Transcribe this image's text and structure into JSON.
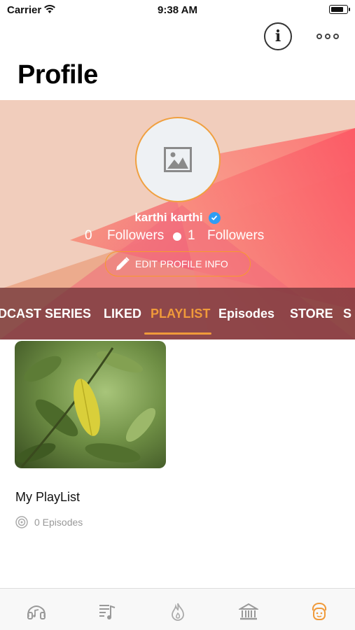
{
  "status_bar": {
    "carrier": "Carrier",
    "time": "9:38 AM",
    "battery_level": 0.85
  },
  "nav": {
    "info_glyph": "i"
  },
  "page_title": "Profile",
  "profile": {
    "name": "karthi karthi",
    "verified": true,
    "followers_count": "0",
    "followers_label": "Followers",
    "following_count": "1",
    "following_label": "Followers",
    "edit_button": "EDIT PROFILE INFO"
  },
  "tabs": [
    {
      "label": "DCAST SERIES",
      "active": false
    },
    {
      "label": "LIKED",
      "active": false
    },
    {
      "label": "PLAYLIST",
      "active": true
    },
    {
      "label": "Episodes",
      "active": false
    },
    {
      "label": "STORE",
      "active": false
    },
    {
      "label": "S",
      "active": false
    }
  ],
  "playlist": {
    "title": "My PlayList",
    "episodes": "0 Episodes"
  },
  "bottom_nav": [
    {
      "icon": "music-icon",
      "active": false
    },
    {
      "icon": "playlist-icon",
      "active": false
    },
    {
      "icon": "flame-icon",
      "active": false
    },
    {
      "icon": "library-icon",
      "active": false
    },
    {
      "icon": "profile-face-icon",
      "active": true
    }
  ],
  "colors": {
    "accent": "#f09a3a",
    "verified": "#2f9df4",
    "banner_base": "#f1cdbc"
  }
}
